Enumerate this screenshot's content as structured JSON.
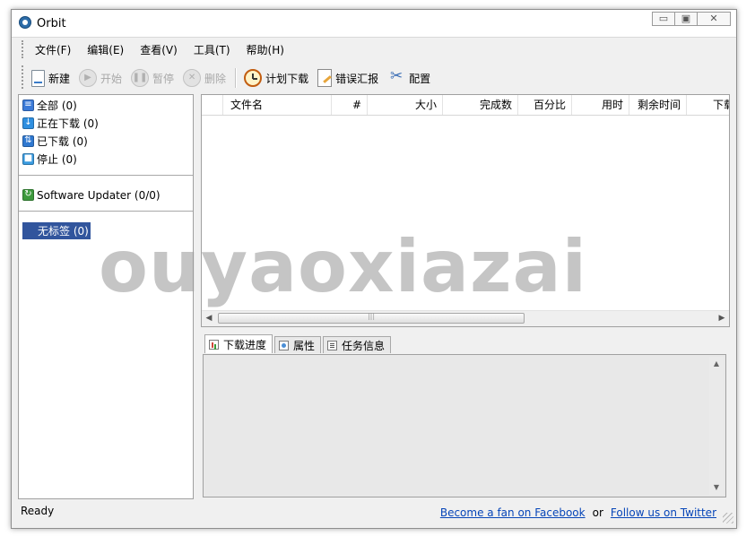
{
  "window": {
    "title": "Orbit",
    "min_glyph": "▭",
    "restore_glyph": "▣",
    "close_glyph": "✕"
  },
  "menu": [
    {
      "label": "文件(F)"
    },
    {
      "label": "编辑(E)"
    },
    {
      "label": "查看(V)"
    },
    {
      "label": "工具(T)"
    },
    {
      "label": "帮助(H)"
    }
  ],
  "toolbar": {
    "new_label": "新建",
    "start_label": "开始",
    "pause_label": "暂停",
    "delete_label": "删除",
    "schedule_label": "计划下载",
    "report_label": "错误汇报",
    "config_label": "配置"
  },
  "sidebar": {
    "categories": [
      {
        "label": "全部 (0)",
        "icon": "list-icon",
        "color": "#3b7ad8",
        "glyph": "≡"
      },
      {
        "label": "正在下载 (0)",
        "icon": "download-arrow-icon",
        "color": "#2f8fe0",
        "glyph": "↓"
      },
      {
        "label": "已下载 (0)",
        "icon": "downloaded-icon",
        "color": "#2f78d0",
        "glyph": "⇅"
      },
      {
        "label": "停止 (0)",
        "icon": "stop-icon",
        "color": "#3a9be0",
        "glyph": "■"
      }
    ],
    "updater": {
      "label": "Software Updater (0/0)",
      "color": "#3d9a3d",
      "glyph": "↻"
    },
    "tag": {
      "label": "无标签 (0)"
    }
  },
  "columns": [
    "",
    "文件名",
    "#",
    "大小",
    "完成数",
    "百分比",
    "用时",
    "剩余时间",
    "下载"
  ],
  "tabs": [
    {
      "label": "下载进度"
    },
    {
      "label": "属性"
    },
    {
      "label": "任务信息"
    }
  ],
  "status": {
    "text": "Ready",
    "facebook_link": "Become a fan on Facebook",
    "or_text": "or",
    "twitter_link": "Follow us on Twitter"
  },
  "watermark": "ouyaoxiazai",
  "colors": {
    "selection": "#31559d",
    "link": "#0645b8"
  }
}
